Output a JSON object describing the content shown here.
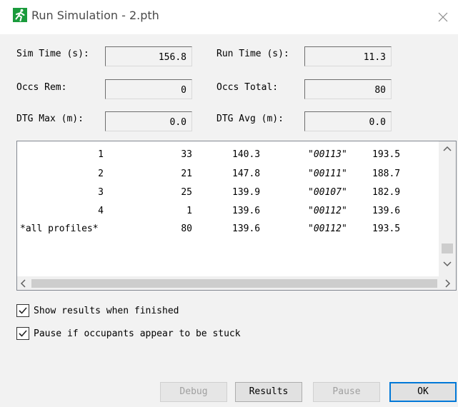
{
  "window": {
    "title": "Run Simulation - 2.pth"
  },
  "stats": {
    "sim_time_label": "Sim Time (s):",
    "sim_time_value": "156.8",
    "run_time_label": "Run Time (s):",
    "run_time_value": "11.3",
    "occs_rem_label": "Occs Rem:",
    "occs_rem_value": "0",
    "occs_total_label": "Occs Total:",
    "occs_total_value": "80",
    "dtg_max_label": "DTG Max (m):",
    "dtg_max_value": "0.0",
    "dtg_avg_label": "DTG Avg (m):",
    "dtg_avg_value": "0.0"
  },
  "results": {
    "rows": [
      [
        "1",
        "33",
        "140.3",
        "\"00113\"",
        "193.5"
      ],
      [
        "2",
        "21",
        "147.8",
        "\"00111\"",
        "188.7"
      ],
      [
        "3",
        "25",
        "139.9",
        "\"00107\"",
        "182.9"
      ],
      [
        "4",
        "1",
        "139.6",
        "\"00112\"",
        "139.6"
      ],
      [
        "*all profiles*",
        "80",
        "139.6",
        "\"00112\"",
        "193.5"
      ]
    ]
  },
  "options": {
    "show_results_label": "Show results when finished",
    "show_results_checked": true,
    "pause_stuck_label": "Pause if occupants appear to be stuck",
    "pause_stuck_checked": true
  },
  "buttons": {
    "debug": "Debug",
    "results": "Results",
    "pause": "Pause",
    "ok": "OK"
  },
  "icons": {
    "app": "running-man-icon",
    "close": "close-icon",
    "scroll_up": "chevron-up-icon",
    "scroll_down": "chevron-down-icon",
    "scroll_left": "chevron-left-icon",
    "scroll_right": "chevron-right-icon"
  },
  "colors": {
    "app_icon_bg": "#1a9b3c",
    "default_button_border": "#0078d7"
  }
}
